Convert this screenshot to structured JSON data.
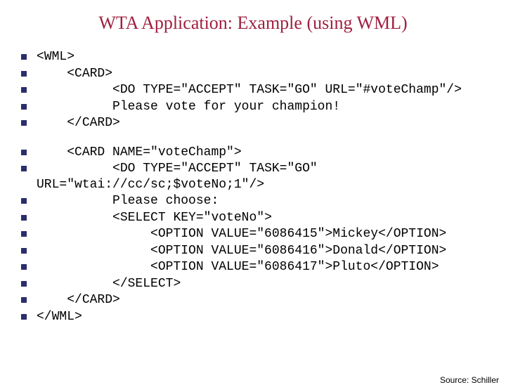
{
  "title": "WTA Application: Example (using WML)",
  "lines_group1": [
    "<WML>",
    "    <CARD>",
    "          <DO TYPE=\"ACCEPT\" TASK=\"GO\" URL=\"#voteChamp\"/>",
    "          Please vote for your champion!",
    "    </CARD>"
  ],
  "lines_group2": [
    "    <CARD NAME=\"voteChamp\">",
    "          <DO TYPE=\"ACCEPT\" TASK=\"GO\" URL=\"wtai://cc/sc;$voteNo;1\"/>",
    "          Please choose:",
    "          <SELECT KEY=\"voteNo\">",
    "               <OPTION VALUE=\"6086415\">Mickey</OPTION>",
    "               <OPTION VALUE=\"6086416\">Donald</OPTION>",
    "               <OPTION VALUE=\"6086417\">Pluto</OPTION>",
    "          </SELECT>",
    "    </CARD>",
    "</WML>"
  ],
  "source": "Source: Schiller"
}
